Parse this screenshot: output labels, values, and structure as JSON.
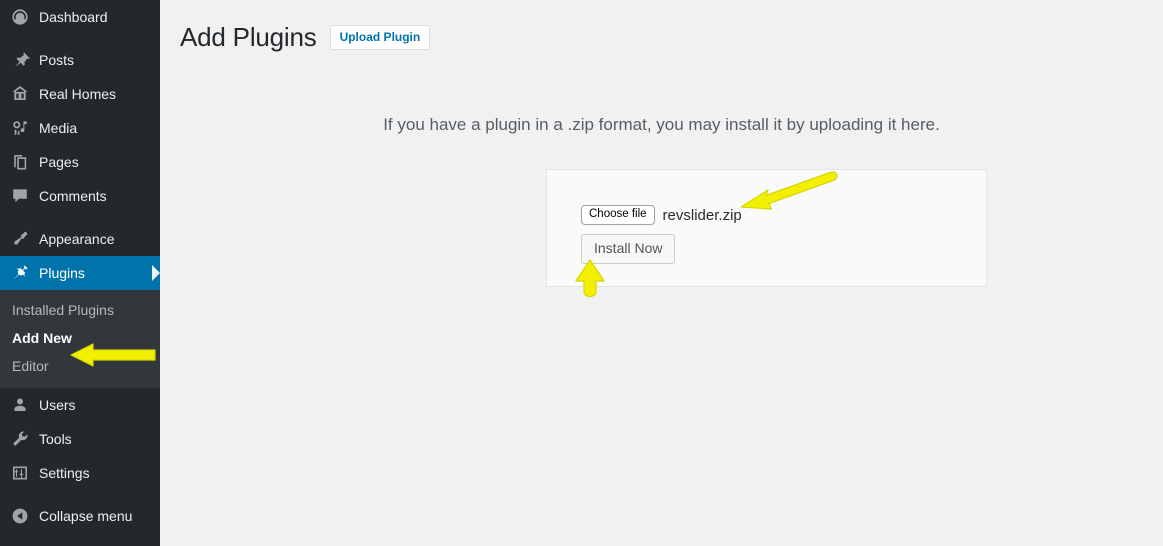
{
  "sidebar": {
    "items": [
      {
        "label": "Dashboard",
        "icon": "dashboard-icon"
      },
      {
        "label": "Posts",
        "icon": "pushpin-icon"
      },
      {
        "label": "Real Homes",
        "icon": "home-icon"
      },
      {
        "label": "Media",
        "icon": "media-icon"
      },
      {
        "label": "Pages",
        "icon": "pages-icon"
      },
      {
        "label": "Comments",
        "icon": "comment-icon"
      },
      {
        "label": "Appearance",
        "icon": "paintbrush-icon"
      },
      {
        "label": "Plugins",
        "icon": "plug-icon"
      },
      {
        "label": "Users",
        "icon": "user-icon"
      },
      {
        "label": "Tools",
        "icon": "wrench-icon"
      },
      {
        "label": "Settings",
        "icon": "sliders-icon"
      }
    ],
    "plugins_submenu": [
      {
        "label": "Installed Plugins"
      },
      {
        "label": "Add New"
      },
      {
        "label": "Editor"
      }
    ],
    "collapse": {
      "label": "Collapse menu",
      "icon": "collapse-arrow-icon"
    }
  },
  "header": {
    "title": "Add Plugins",
    "upload_plugin_label": "Upload Plugin"
  },
  "main": {
    "instructions": "If you have a plugin in a .zip format, you may install it by uploading it here.",
    "choose_file_label": "Choose file",
    "file_name": "revslider.zip",
    "install_now_label": "Install Now"
  },
  "colors": {
    "accent": "#0073aa",
    "sidebar_bg": "#23282d",
    "submenu_bg": "#32373c",
    "page_bg": "#f1f1f1",
    "annotation": "#f2ef00"
  }
}
